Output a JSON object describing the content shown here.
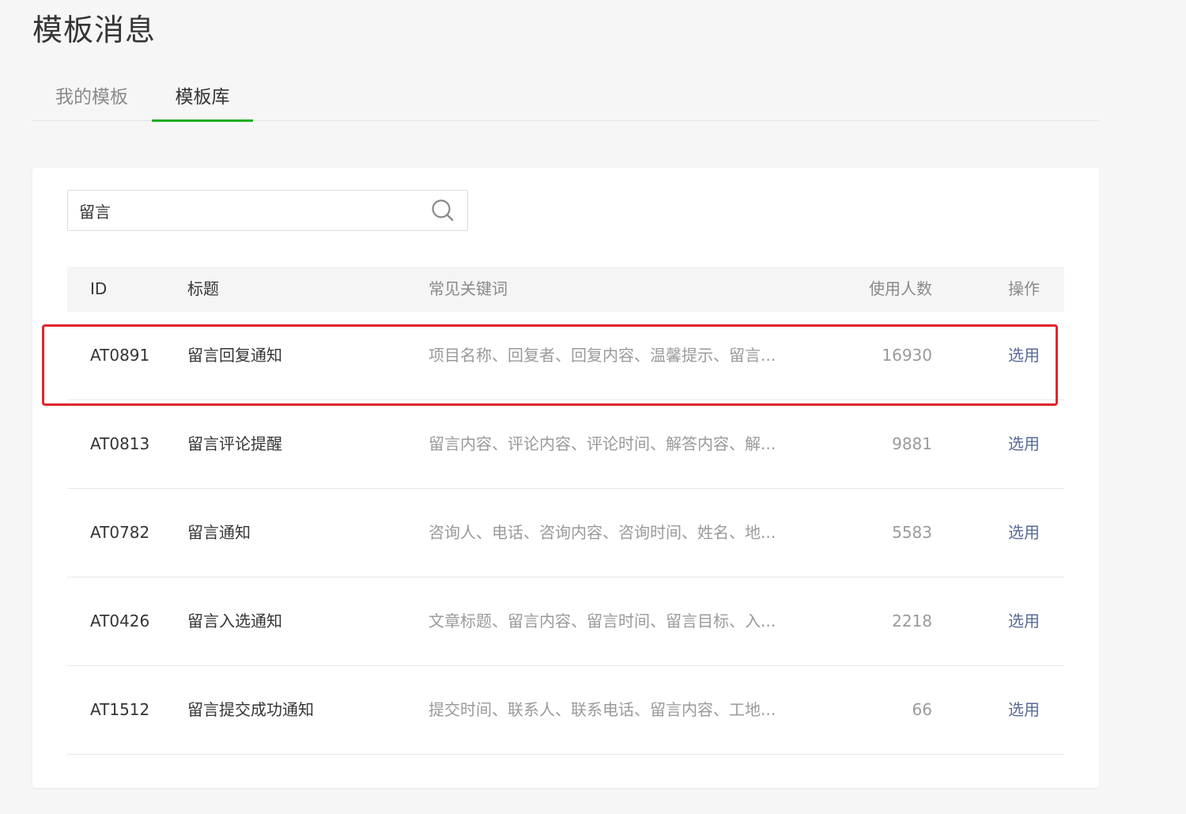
{
  "page": {
    "title": "模板消息"
  },
  "tabs": [
    {
      "label": "我的模板",
      "active": false
    },
    {
      "label": "模板库",
      "active": true
    }
  ],
  "search": {
    "value": "留言"
  },
  "table": {
    "headers": {
      "id": "ID",
      "title": "标题",
      "keywords": "常见关键词",
      "usage": "使用人数",
      "action": "操作"
    },
    "rows": [
      {
        "id": "AT0891",
        "title": "留言回复通知",
        "keywords": "项目名称、回复者、回复内容、温馨提示、留言...",
        "usage": "16930",
        "action": "选用"
      },
      {
        "id": "AT0813",
        "title": "留言评论提醒",
        "keywords": "留言内容、评论内容、评论时间、解答内容、解...",
        "usage": "9881",
        "action": "选用"
      },
      {
        "id": "AT0782",
        "title": "留言通知",
        "keywords": "咨询人、电话、咨询内容、咨询时间、姓名、地...",
        "usage": "5583",
        "action": "选用"
      },
      {
        "id": "AT0426",
        "title": "留言入选通知",
        "keywords": "文章标题、留言内容、留言时间、留言目标、入...",
        "usage": "2218",
        "action": "选用"
      },
      {
        "id": "AT1512",
        "title": "留言提交成功通知",
        "keywords": "提交时间、联系人、联系电话、留言内容、工地...",
        "usage": "66",
        "action": "选用"
      }
    ]
  },
  "highlight": {
    "row_index": 2,
    "color": "#e0262b"
  },
  "colors": {
    "accent_green": "#1aad19",
    "link_blue": "#576b95"
  }
}
